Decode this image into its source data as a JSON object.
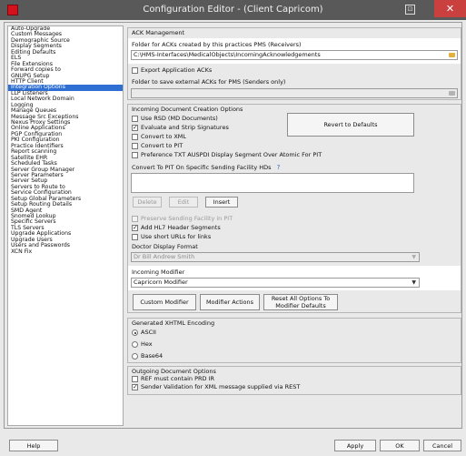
{
  "window": {
    "title": "Configuration Editor - (Client Capricom)",
    "close_glyph": "✕",
    "app_icon": "app-logo-icon"
  },
  "sidebar": {
    "items": [
      "Auto-Upgrade",
      "Custom Messages",
      "Demographic Source",
      "Display Segments",
      "Editing Defaults",
      "ELS",
      "File Extensions",
      "Forward copies to",
      "GNUPG Setup",
      "HTTP Client",
      "Integration Options",
      "LLP Listeners",
      "Local Network Domain",
      "Logging",
      "Manage Queues",
      "Message Src Exceptions",
      "Nexus Proxy Settings",
      "Online Applications",
      "PGP Configuration",
      "PKI Configuration",
      "Practice Identifiers",
      "Report scanning",
      "Satellite EHR",
      "Scheduled Tasks",
      "Server Group Manager",
      "Server Parameters",
      "Server Setup",
      "Servers to Route to",
      "Service Configuration",
      "Setup Global Parameters",
      "Setup Routing Details",
      "SMD Agent",
      "Snomed Lookup",
      "Specific Servers",
      "TLS Servers",
      "Upgrade Applications",
      "Upgrade Users",
      "Users and Passwords",
      "XCN Fix"
    ],
    "selected_label": "Integration Options"
  },
  "ack": {
    "group_title": "ACK Management",
    "receivers_label": "Folder for ACKs created by this practices PMS (Receivers)",
    "receivers_path": "C:\\HMS-Interfaces\\MedicalObjects\\IncomingAcknowledgements",
    "export_label": "Export Application ACKs",
    "senders_label": "Folder to save external ACKs for PMS (Senders only)",
    "senders_path": ""
  },
  "incoming": {
    "group_title": "Incoming Document Creation Options",
    "checkboxes": [
      {
        "label": "Use RSD (MD Documents)",
        "checked": false
      },
      {
        "label": "Evaluate and Strip Signatures",
        "checked": true
      },
      {
        "label": "Convert to XML",
        "checked": false
      },
      {
        "label": "Convert to PIT",
        "checked": false
      },
      {
        "label": "Preference TXT AUSPDI Display Segment Over Atomic For PIT",
        "checked": false
      }
    ],
    "revert_label": "Revert to Defaults",
    "hds_label": "Convert To PIT On Specific Sending Facility HDs",
    "help_mark": "?",
    "delete_label": "Delete",
    "edit_label": "Edit",
    "insert_label": "Insert",
    "checkboxes2": [
      {
        "label": "Preserve Sending Facility in PIT",
        "checked": false,
        "disabled": true
      },
      {
        "label": "Add HL7 Header Segments",
        "checked": true,
        "disabled": false
      },
      {
        "label": "Use short URLs for links",
        "checked": false,
        "disabled": false
      }
    ],
    "doctor_format_label": "Doctor Display Format",
    "doctor_format_value": "Dr Bill Andrew Smith",
    "modifier_label": "Incoming Modifier",
    "modifier_value": "Capricorn Modifier",
    "custom_modifier_label": "Custom Modifier",
    "modifier_actions_label": "Modifier Actions",
    "reset_label_1": "Reset All Options To",
    "reset_label_2": "Modifier Defaults"
  },
  "xhtml": {
    "group_title": "Generated XHTML Encoding",
    "options": [
      {
        "label": "ASCII",
        "selected": true
      },
      {
        "label": "Hex",
        "selected": false
      },
      {
        "label": "Base64",
        "selected": false
      }
    ]
  },
  "outgoing": {
    "group_title": "Outgoing Document Options",
    "checkboxes": [
      {
        "label": "REF must contain PRD IR",
        "checked": false
      },
      {
        "label": "Sender Validation for XML message supplied via REST",
        "checked": true
      }
    ]
  },
  "footer": {
    "help_label": "Help",
    "apply_label": "Apply",
    "ok_label": "OK",
    "cancel_label": "Cancel"
  },
  "colors": {
    "selection": "#2f6fd3",
    "close": "#c9403f",
    "folder": "#e3b03b"
  }
}
